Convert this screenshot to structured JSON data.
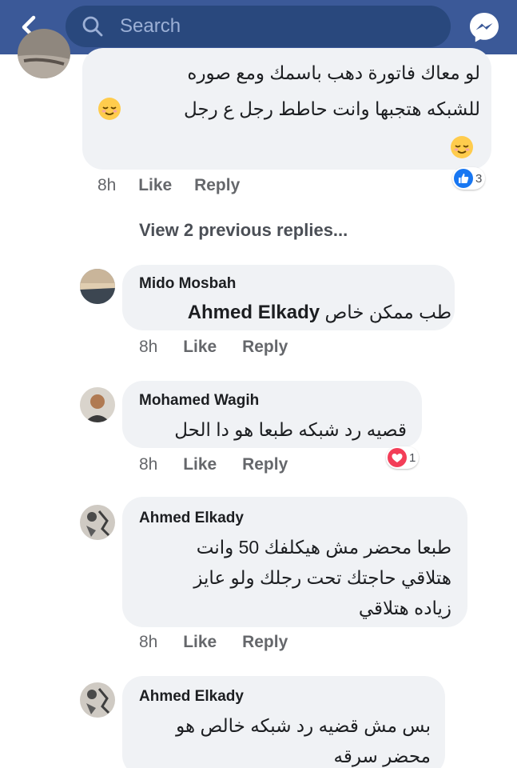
{
  "header": {
    "search_placeholder": "Search"
  },
  "top_comment": {
    "line1": "لو معاك فاتورة دهب باسمك ومع صوره",
    "line2": "للشبكه هتجبها وانت حاطط رجل ع رجل",
    "time": "8h",
    "like_label": "Like",
    "reply_label": "Reply",
    "reaction_count": "3"
  },
  "view_previous": "View 2 previous replies...",
  "replies": [
    {
      "author": "Mido Mosbah",
      "mention": "Ahmed Elkady",
      "text": "طب ممكن خاص",
      "time": "8h",
      "like_label": "Like",
      "reply_label": "Reply"
    },
    {
      "author": "Mohamed Wagih",
      "text": "قصيه رد شبكه طبعا هو دا الحل",
      "time": "8h",
      "like_label": "Like",
      "reply_label": "Reply",
      "reaction_count": "1"
    },
    {
      "author": "Ahmed Elkady",
      "line1": "طبعا محضر مش هيكلفك 50 وانت",
      "line2": "هتلاقي حاجتك تحت رجلك ولو عايز",
      "line3": "زياده هتلاقي",
      "time": "8h",
      "like_label": "Like",
      "reply_label": "Reply"
    },
    {
      "author": "Ahmed Elkady",
      "line1": "بس مش قضيه رد شبكه خالص هو",
      "line2": "محضر سرقه"
    }
  ],
  "colors": {
    "header_bg": "#3b5998",
    "search_bg": "#29487d",
    "bubble_bg": "#f0f2f5",
    "like_blue": "#1877f2",
    "love_red": "#f33e58"
  }
}
